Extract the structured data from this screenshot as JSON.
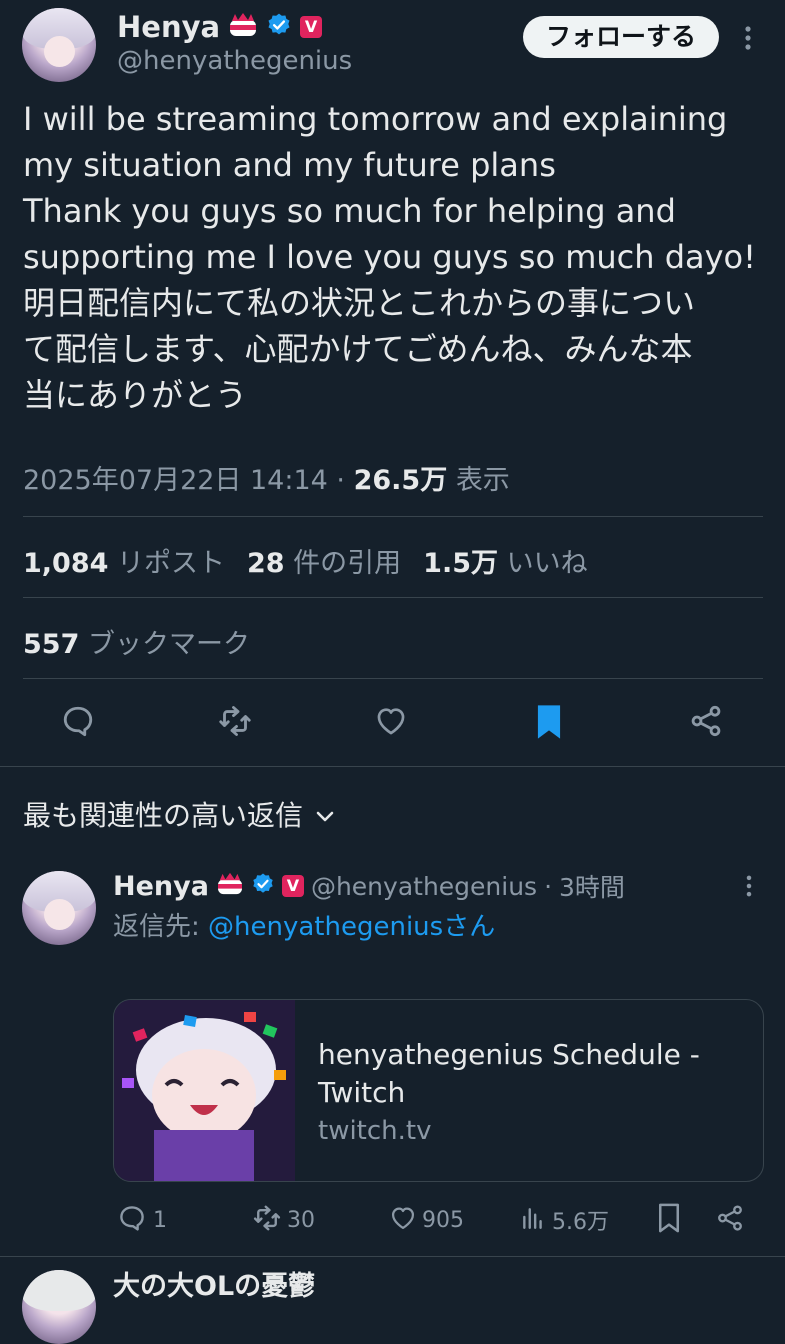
{
  "tweet": {
    "author": {
      "name": "Henya",
      "handle": "@henyathegenius",
      "badge_v": "V"
    },
    "follow_label": "フォローする",
    "text": "I will be streaming tomorrow and explaining\nmy situation and my future plans\nThank you guys so much for helping and\nsupporting me I love you guys so much dayo!\n明日配信内にて私の状況とこれからの事につい\nて配信します、心配かけてごめんね、みんな本\n当にありがとう",
    "timestamp": "2025年07月22日 14:14",
    "views": "26.5万",
    "views_label": "表示",
    "stats": {
      "reposts_count": "1,084",
      "reposts_label": "リポスト",
      "quotes_count": "28",
      "quotes_label": "件の引用",
      "likes_count": "1.5万",
      "likes_label": "いいね",
      "bookmarks_count": "557",
      "bookmarks_label": "ブックマーク"
    }
  },
  "replies_sort_label": "最も関連性の高い返信",
  "reply": {
    "name": "Henya",
    "handle": "@henyathegenius",
    "time": "3時間",
    "badge_v": "V",
    "reply_to_prefix": "返信先: ",
    "reply_to_handle": "@henyathegenius",
    "reply_to_suffix": "さん",
    "card": {
      "title": "henyathegenius Schedule - Twitch",
      "domain": "twitch.tv"
    },
    "actions": {
      "replies": "1",
      "reposts": "30",
      "likes": "905",
      "views": "5.6万"
    }
  },
  "next_reply_partial": "大の大OLの憂鬱",
  "colors": {
    "background": "#15202b",
    "accent": "#1d9bf0",
    "muted": "#8b98a5",
    "badge": "#e0245e"
  }
}
